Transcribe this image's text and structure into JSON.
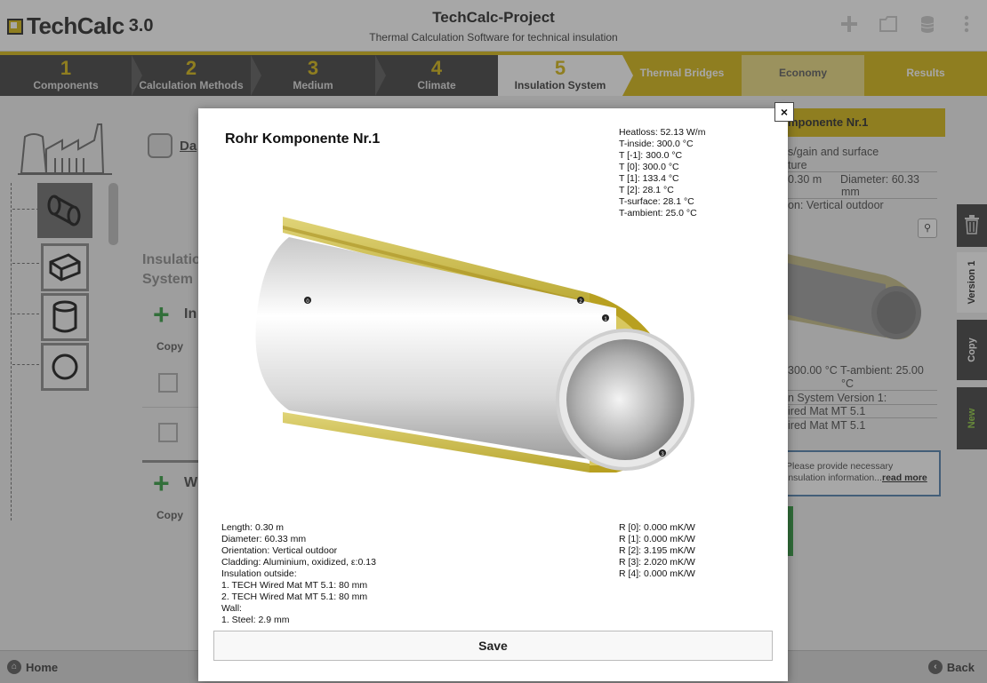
{
  "app": {
    "logo_text": "TechCalc",
    "logo_version": "3.0",
    "project_title": "TechCalc-Project",
    "subtitle": "Thermal Calculation Software for technical insulation"
  },
  "steps": [
    {
      "num": "1",
      "label": "Components"
    },
    {
      "num": "2",
      "label": "Calculation Methods"
    },
    {
      "num": "3",
      "label": "Medium"
    },
    {
      "num": "4",
      "label": "Climate"
    },
    {
      "num": "5",
      "label": "Insulation System"
    }
  ],
  "extra_tabs": [
    "Thermal Bridges",
    "Economy",
    "Results"
  ],
  "background": {
    "data_label": "Da",
    "insulation_title_1": "Insulatio",
    "insulation_title_2": "System",
    "section1_label": "In",
    "section2_label": "W",
    "copy_label": "Copy",
    "right_title": "mponente Nr.1",
    "right_lines": [
      "s/gain and surface",
      "ture",
      "0.30 m      Diameter: 60.33",
      "mm",
      "on: Vertical outdoor"
    ],
    "right_lines2": [
      "300.00 °C T-ambient: 25.00",
      "°C",
      "n System Version 1:",
      "ired Mat MT 5.1",
      "ired Mat MT 5.1"
    ],
    "note_text": "Please provide necessary insulation information...",
    "note_link": "read more",
    "side_tabs": [
      "Version 1",
      "Copy",
      "New"
    ]
  },
  "footer": {
    "home": "Home",
    "back": "Back"
  },
  "modal": {
    "close": "×",
    "title": "Rohr Komponente Nr.1",
    "temps": [
      "Heatloss: 52.13 W/m",
      "T-inside: 300.0 °C",
      "T [-1]: 300.0 °C",
      "T [0]: 300.0 °C",
      "T [1]: 133.4 °C",
      "T [2]: 28.1 °C",
      "T-surface: 28.1 °C",
      "T-ambient: 25.0 °C"
    ],
    "props": [
      "Length: 0.30 m",
      "Diameter: 60.33 mm",
      "Orientation: Vertical outdoor",
      "Cladding: Aluminium, oxidized, ε:0.13",
      "Insulation outside:",
      "1. TECH Wired Mat MT 5.1: 80 mm",
      "2. TECH Wired Mat MT 5.1: 80 mm",
      "Wall:",
      "1. Steel: 2.9 mm"
    ],
    "resistances": [
      "R [0]: 0.000 mK/W",
      "R [1]: 0.000 mK/W",
      "R [2]: 3.195 mK/W",
      "R [3]: 2.020 mK/W",
      "R [4]: 0.000 mK/W"
    ],
    "markers": [
      "0",
      "1",
      "2",
      "3"
    ],
    "save_label": "Save"
  },
  "colors": {
    "accent_yellow": "#d4b40a",
    "dark_bar": "#3a3a3a",
    "green": "#2a9a3a"
  }
}
